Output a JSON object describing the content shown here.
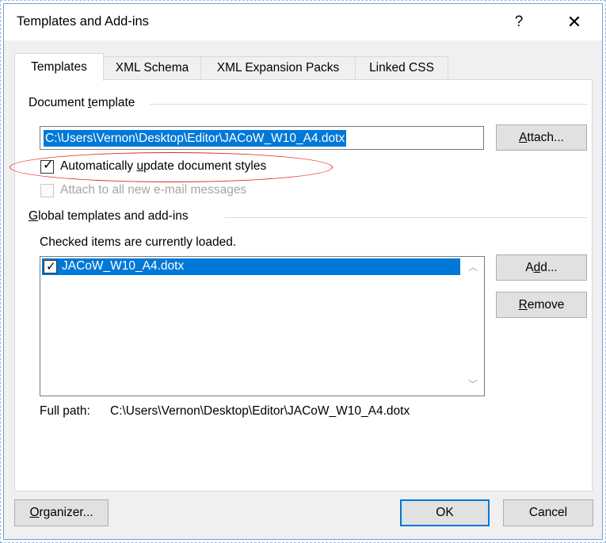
{
  "window": {
    "title": "Templates and Add-ins",
    "help_label": "?",
    "close_label": "✕"
  },
  "tabs": [
    {
      "label": "Templates",
      "active": true
    },
    {
      "label": "XML Schema",
      "active": false
    },
    {
      "label": "XML Expansion Packs",
      "active": false
    },
    {
      "label": "Linked CSS",
      "active": false
    }
  ],
  "document_template": {
    "group_title_pre": "Document ",
    "group_title_key": "t",
    "group_title_post": "emplate",
    "path_value": "C:\\Users\\Vernon\\Desktop\\Editor\\JACoW_W10_A4.dotx",
    "attach_pre": "",
    "attach_key": "A",
    "attach_post": "ttach...",
    "auto_update_pre": "Automatically ",
    "auto_update_key": "u",
    "auto_update_post": "pdate document styles",
    "auto_update_checked": true,
    "attach_email_label": "Attach to all new e-mail messages",
    "attach_email_checked": false,
    "attach_email_disabled": true
  },
  "global_templates": {
    "group_title_pre": "",
    "group_title_key": "G",
    "group_title_post": "lobal templates and add-ins",
    "hint": "Checked items are currently loaded.",
    "items": [
      {
        "label": "JACoW_W10_A4.dotx",
        "checked": true,
        "selected": true
      }
    ],
    "add_pre": "A",
    "add_key": "d",
    "add_post": "d...",
    "remove_pre": "",
    "remove_key": "R",
    "remove_post": "emove",
    "full_path_label": "Full path:",
    "full_path_value": "C:\\Users\\Vernon\\Desktop\\Editor\\JACoW_W10_A4.dotx"
  },
  "footer": {
    "organizer_pre": "",
    "organizer_key": "O",
    "organizer_post": "rganizer...",
    "ok_label": "OK",
    "cancel_label": "Cancel"
  },
  "colors": {
    "selection": "#0078d7",
    "annotation_ellipse": "#e02a2a"
  }
}
